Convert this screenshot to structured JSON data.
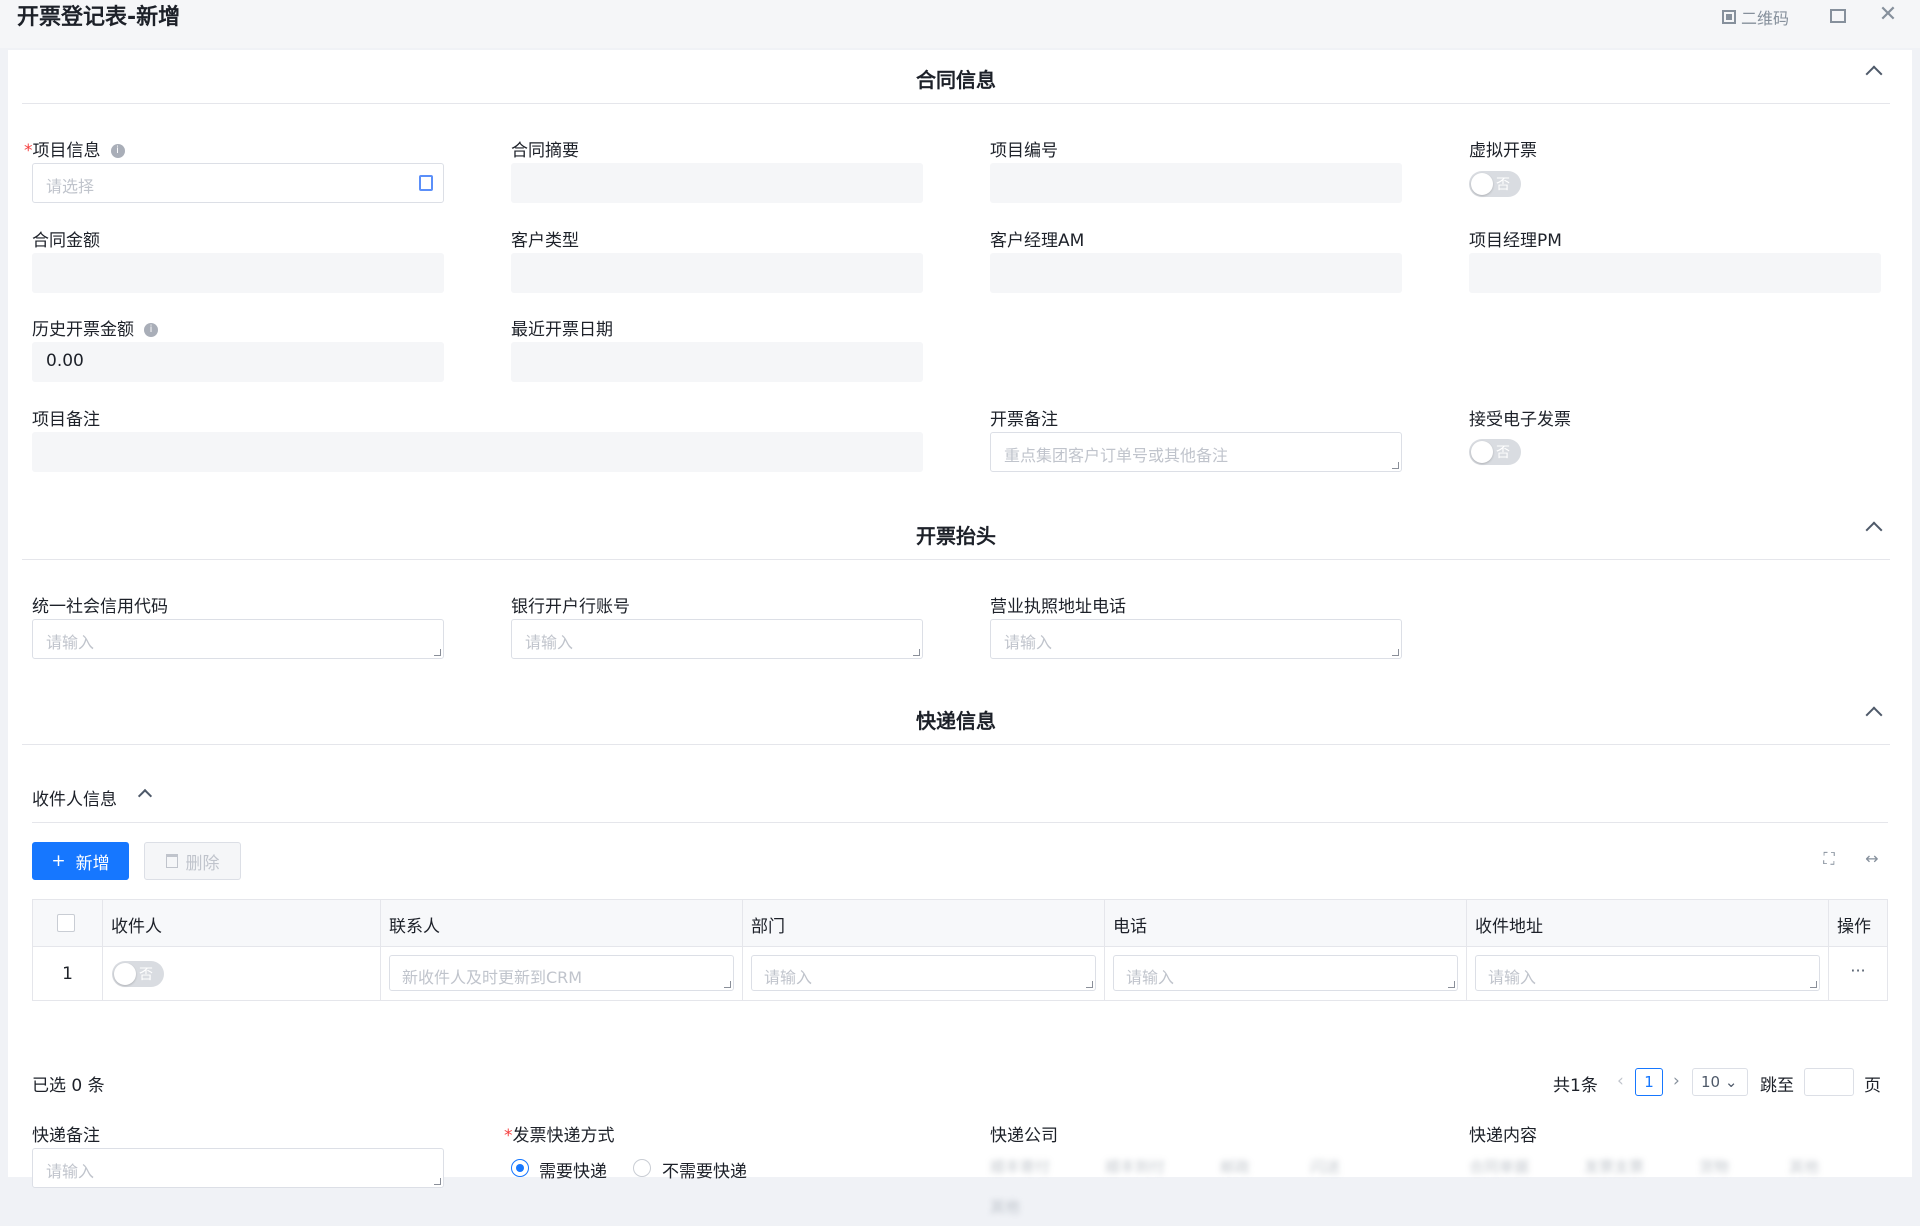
{
  "window": {
    "title": "开票登记表-新增",
    "qr_label": "二维码"
  },
  "sections": {
    "contract": "合同信息",
    "invoice_header": "开票抬头",
    "express": "快递信息"
  },
  "contract": {
    "project_info": {
      "label": "项目信息",
      "required_mark": "*",
      "placeholder": "请选择"
    },
    "contract_summary": {
      "label": "合同摘要"
    },
    "project_no": {
      "label": "项目编号"
    },
    "virtual_invoice": {
      "label": "虚拟开票",
      "toggle": "否"
    },
    "contract_amount": {
      "label": "合同金额"
    },
    "customer_type": {
      "label": "客户类型"
    },
    "account_manager": {
      "label": "客户经理AM"
    },
    "project_manager": {
      "label": "项目经理PM"
    },
    "history_amount": {
      "label": "历史开票金额",
      "value": "0.00"
    },
    "last_date": {
      "label": "最近开票日期"
    },
    "project_remark": {
      "label": "项目备注"
    },
    "invoice_remark": {
      "label": "开票备注",
      "placeholder": "重点集团客户订单号或其他备注"
    },
    "e_invoice": {
      "label": "接受电子发票",
      "toggle": "否"
    }
  },
  "invoice_header": {
    "credit_code": {
      "label": "统一社会信用代码",
      "placeholder": "请输入"
    },
    "bank_account": {
      "label": "银行开户行账号",
      "placeholder": "请输入"
    },
    "license_address": {
      "label": "营业执照地址电话",
      "placeholder": "请输入"
    }
  },
  "express": {
    "recipient_group": "收件人信息",
    "add_button": "新增",
    "delete_button": "删除",
    "table": {
      "columns": [
        "收件人",
        "联系人",
        "部门",
        "电话",
        "收件地址",
        "操作"
      ],
      "rows": [
        {
          "index": "1",
          "recipient_toggle": "否",
          "contact_placeholder": "新收件人及时更新到CRM",
          "dept_placeholder": "请输入",
          "phone_placeholder": "请输入",
          "address_placeholder": "请输入",
          "action": "···"
        }
      ]
    },
    "selected_text": "已选 0 条",
    "pager": {
      "total": "共1条",
      "page": "1",
      "page_size": "10",
      "goto_label": "跳至",
      "page_unit": "页"
    },
    "remark": {
      "label": "快递备注",
      "placeholder": "请输入"
    },
    "method": {
      "label": "发票快递方式",
      "required_mark": "*",
      "options": [
        "需要快递",
        "不需要快递"
      ],
      "selected": "需要快递"
    },
    "company": {
      "label": "快递公司",
      "options": [
        "顺丰寄付",
        "顺丰到付",
        "邮政",
        "闪送",
        "其他"
      ]
    },
    "content": {
      "label": "快递内容",
      "options": [
        "合同单据",
        "发票支票",
        "货物",
        "其他"
      ]
    }
  }
}
